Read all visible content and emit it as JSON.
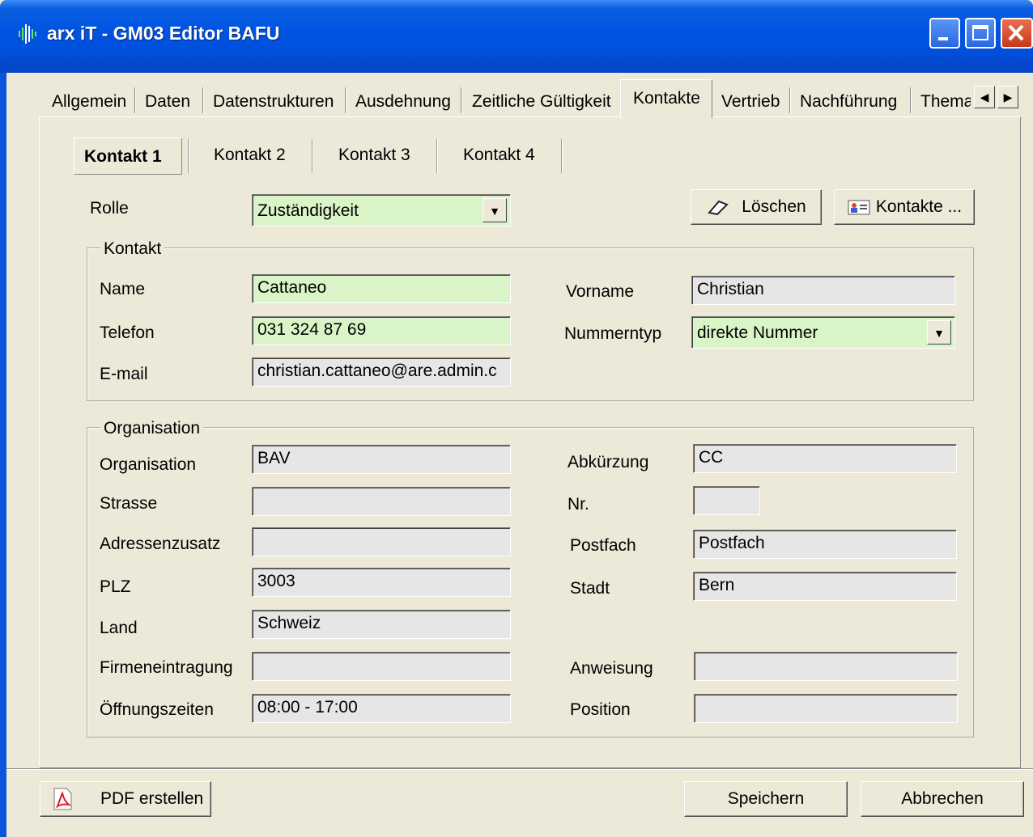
{
  "window": {
    "title": "arx iT - GM03 Editor BAFU"
  },
  "tabs": [
    "Allgemein",
    "Daten",
    "Datenstrukturen",
    "Ausdehnung",
    "Zeitliche Gültigkeit",
    "Kontakte",
    "Vertrieb",
    "Nachführung",
    "Thema"
  ],
  "subtabs": [
    "Kontakt 1",
    "Kontakt 2",
    "Kontakt 3",
    "Kontakt 4"
  ],
  "rolle": {
    "label": "Rolle",
    "value": "Zuständigkeit"
  },
  "buttons": {
    "loeschen": "Löschen",
    "kontakte": "Kontakte ...",
    "pdf": "PDF erstellen",
    "speichern": "Speichern",
    "abbrechen": "Abbrechen"
  },
  "kontakt": {
    "title": "Kontakt",
    "name_label": "Name",
    "name": "Cattaneo",
    "vorname_label": "Vorname",
    "vorname": "Christian",
    "telefon_label": "Telefon",
    "telefon": "031 324 87 69",
    "nummerntyp_label": "Nummerntyp",
    "nummerntyp": "direkte Nummer",
    "email_label": "E-mail",
    "email": "christian.cattaneo@are.admin.c"
  },
  "organisation": {
    "title": "Organisation",
    "organisation_label": "Organisation",
    "organisation": "BAV",
    "abkuerzung_label": "Abkürzung",
    "abkuerzung": "CC",
    "strasse_label": "Strasse",
    "strasse": "",
    "nr_label": "Nr.",
    "nr": "",
    "adressenzusatz_label": "Adressenzusatz",
    "adressenzusatz": "",
    "postfach_label": "Postfach",
    "postfach": "Postfach",
    "plz_label": "PLZ",
    "plz": "3003",
    "stadt_label": "Stadt",
    "stadt": "Bern",
    "land_label": "Land",
    "land": "Schweiz",
    "firmeneintragung_label": "Firmeneintragung",
    "firmeneintragung": "",
    "anweisung_label": "Anweisung",
    "anweisung": "",
    "oeffnungszeiten_label": "Öffnungszeiten",
    "oeffnungszeiten": "08:00 - 17:00",
    "position_label": "Position",
    "position": ""
  }
}
